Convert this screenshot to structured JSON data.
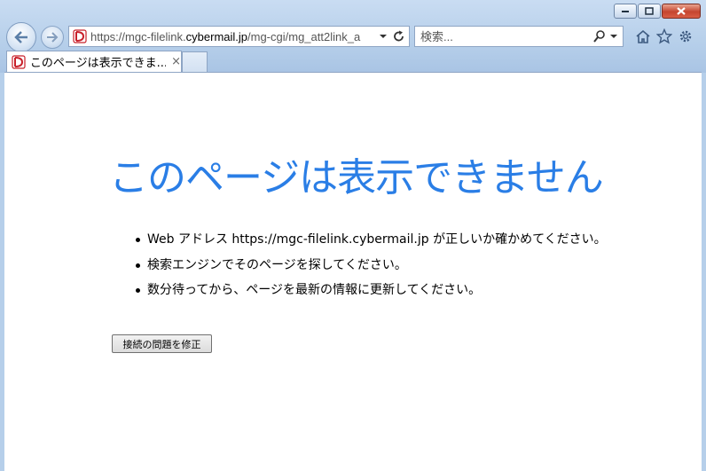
{
  "browser": {
    "address_scheme": "https://mgc-filelink.",
    "address_host": "cybermail.jp",
    "address_path": "/mg-cgi/mg_att2link_a",
    "search_placeholder": "検索...",
    "tab_title": "このページは表示できま...",
    "tab_close": "×"
  },
  "page": {
    "title": "このページは表示できません",
    "bullets": [
      "Web アドレス https://mgc-filelink.cybermail.jp が正しいか確かめてください。",
      "検索エンジンでそのページを探してください。",
      "数分待ってから、ページを最新の情報に更新してください。"
    ],
    "fix_button": "接続の問題を修正"
  },
  "colors": {
    "title_blue": "#2a7ee6",
    "frame_blue": "#b6cfea",
    "close_red": "#c5452f"
  },
  "icons": [
    "back-arrow-icon",
    "forward-arrow-icon",
    "site-favicon",
    "dropdown-arrow-icon",
    "refresh-icon",
    "search-icon",
    "home-icon",
    "favorites-star-icon",
    "settings-gear-icon"
  ]
}
